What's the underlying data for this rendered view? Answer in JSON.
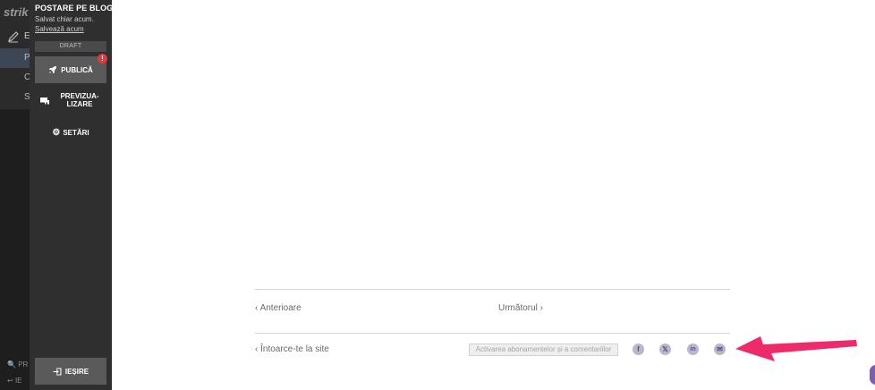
{
  "back_sidebar": {
    "logo_text": "strik",
    "row_letters": [
      "E",
      "P",
      "C",
      "S"
    ],
    "footer_1": "PR",
    "footer_2": "IE"
  },
  "editor": {
    "title": "POSTARE PE BLOG",
    "saved_status": "Salvat chiar acum.",
    "save_now_link": "Salvează acum",
    "draft_badge": "DRAFT",
    "publish_label": "PUBLICĂ",
    "alert_badge": "!",
    "preview_label_line1": "PREVIZUA-",
    "preview_label_line2": "LIZARE",
    "settings_label": "SETĂRI",
    "exit_label": "IEȘIRE"
  },
  "post_nav": {
    "previous": "Anterioare",
    "next": "Următorul"
  },
  "footer": {
    "back_to_site": "Întoarce-te la site",
    "subscribe_button": "Activarea abonamentelor și a comentariilor",
    "share_icons": [
      {
        "name": "facebook-icon",
        "glyph": "f"
      },
      {
        "name": "x-icon",
        "glyph": "𝕏"
      },
      {
        "name": "linkedin-icon",
        "glyph": "in"
      },
      {
        "name": "email-icon",
        "glyph": "✉"
      }
    ]
  },
  "colors": {
    "panel_bg": "#2f2f2f",
    "button_bg": "#5a5a5a",
    "alert": "#e0393e",
    "annotation_arrow": "#ee2a6a",
    "share_icon_fg": "#5a4b8a"
  }
}
